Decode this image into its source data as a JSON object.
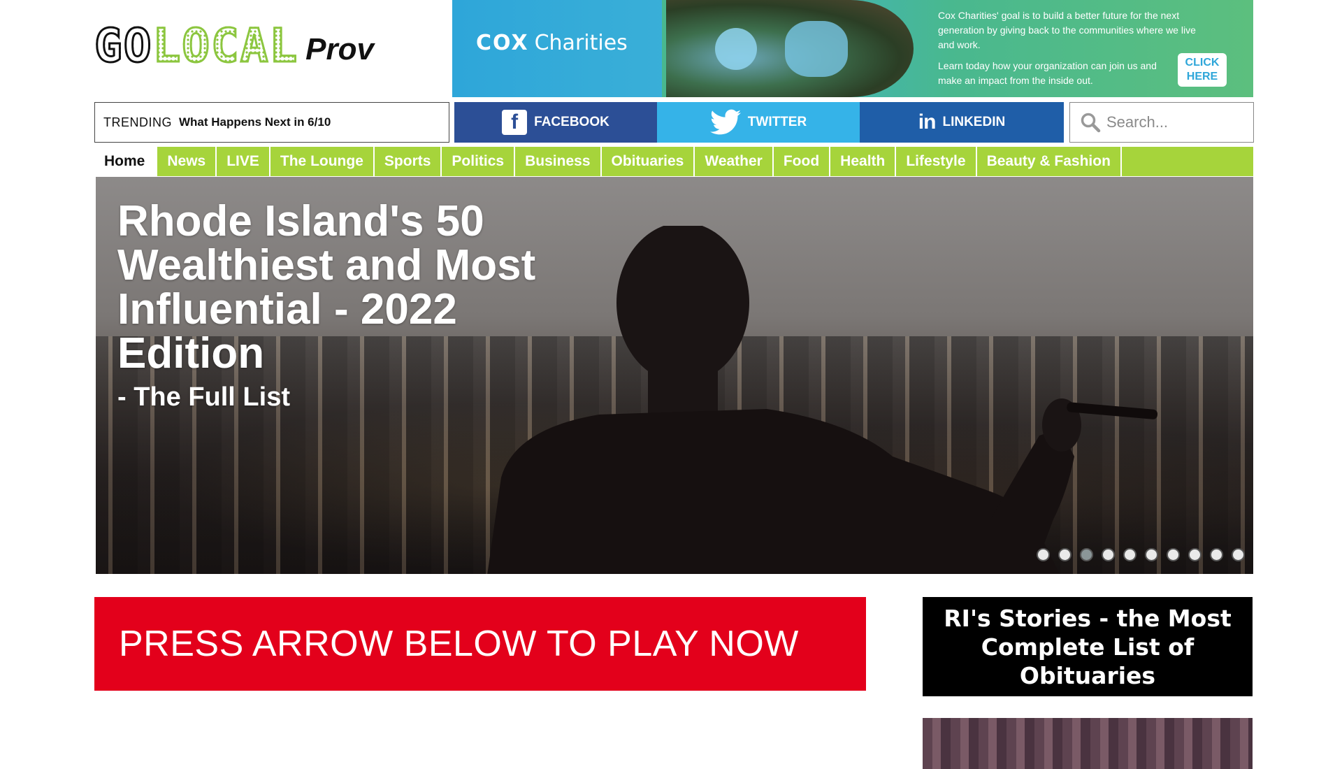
{
  "logo": {
    "part1": "GO",
    "part2": "LOCAL",
    "part3": "Prov"
  },
  "ad": {
    "brand_bold": "COX",
    "brand_rest": "Charities",
    "text1": "Cox Charities' goal is to build a better future for the next generation by giving back to the communities where we live and work.",
    "text2": "Learn today how your organization can join us and make an impact from the inside out.",
    "cta": "CLICK HERE"
  },
  "trending": {
    "label": "TRENDING",
    "text": "What Happens Next in 6/10"
  },
  "social": {
    "facebook": "FACEBOOK",
    "twitter": "TWITTER",
    "linkedin": "LINKEDIN"
  },
  "search": {
    "placeholder": "Search..."
  },
  "nav": {
    "items": [
      "Home",
      "News",
      "LIVE",
      "The Lounge",
      "Sports",
      "Politics",
      "Business",
      "Obituaries",
      "Weather",
      "Food",
      "Health",
      "Lifestyle",
      "Beauty & Fashion"
    ]
  },
  "hero": {
    "title": "Rhode Island's 50 Wealthiest and Most Influential - 2022 Edition",
    "subtitle": "- The Full List",
    "slide_count": 10,
    "active_slide": 3
  },
  "play_banner": {
    "text": "PRESS ARROW BELOW TO PLAY NOW"
  },
  "obituaries": {
    "text": "RI's Stories - the Most Complete List of Obituaries"
  },
  "colors": {
    "nav_green": "#a6d43b",
    "facebook": "#2c4f96",
    "twitter": "#35b3e8",
    "linkedin": "#1f5ea8",
    "play_red": "#e3001b"
  }
}
